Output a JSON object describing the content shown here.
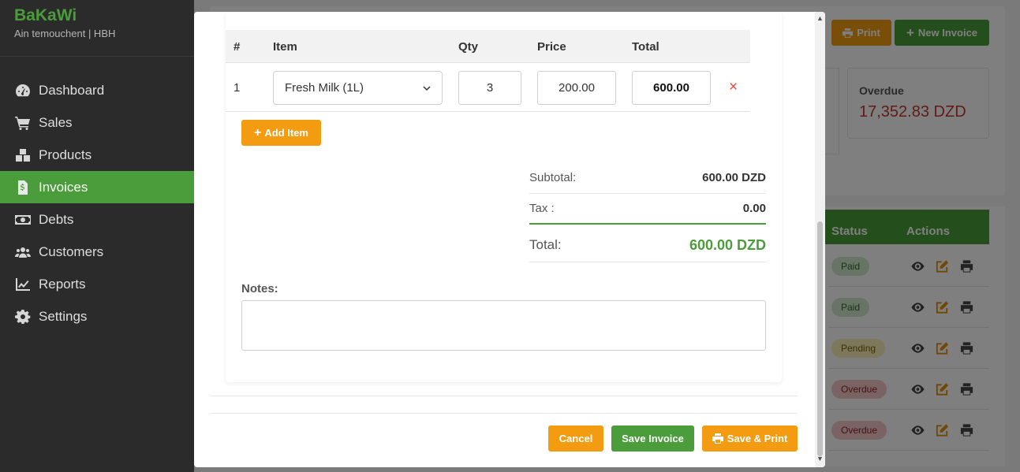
{
  "sidebar": {
    "brand": "BaKaWi",
    "subtitle": "Ain temouchent | HBH",
    "items": [
      {
        "label": "Dashboard",
        "icon": "gauge-icon"
      },
      {
        "label": "Sales",
        "icon": "cart-icon"
      },
      {
        "label": "Products",
        "icon": "boxes-icon"
      },
      {
        "label": "Invoices",
        "icon": "invoice-icon",
        "active": true
      },
      {
        "label": "Debts",
        "icon": "money-icon"
      },
      {
        "label": "Customers",
        "icon": "users-icon"
      },
      {
        "label": "Reports",
        "icon": "chart-line-icon"
      },
      {
        "label": "Settings",
        "icon": "gear-icon"
      }
    ]
  },
  "background": {
    "print_label": "Print",
    "new_invoice_label": "New Invoice",
    "overdue_card": {
      "label": "Overdue",
      "value": "17,352.83 DZD"
    },
    "table": {
      "status_header": "Status",
      "actions_header": "Actions",
      "rows": [
        {
          "status": "Paid",
          "kind": "paid"
        },
        {
          "status": "Paid",
          "kind": "paid"
        },
        {
          "status": "Pending",
          "kind": "pending"
        },
        {
          "status": "Overdue",
          "kind": "overdue"
        },
        {
          "status": "Overdue",
          "kind": "overdue"
        }
      ]
    }
  },
  "modal": {
    "columns": [
      "#",
      "Item",
      "Qty",
      "Price",
      "Total"
    ],
    "rows": [
      {
        "num": "1",
        "item": "Fresh Milk (1L)",
        "qty": "3",
        "price": "200.00",
        "total": "600.00",
        "delete": "×"
      }
    ],
    "add_item_label": "Add Item",
    "subtotal_label": "Subtotal:",
    "subtotal_value": "600.00 DZD",
    "tax_label": "Tax :",
    "tax_value": "0.00",
    "total_label": "Total:",
    "total_value": "600.00 DZD",
    "notes_label": "Notes:",
    "notes_value": "",
    "cancel_label": "Cancel",
    "save_label": "Save Invoice",
    "save_print_label": "Save & Print"
  },
  "colors": {
    "brand_green": "#4a9d3a",
    "orange": "#f39c12",
    "danger": "#e74c3c",
    "sidebar_bg": "#2b2b2b"
  }
}
